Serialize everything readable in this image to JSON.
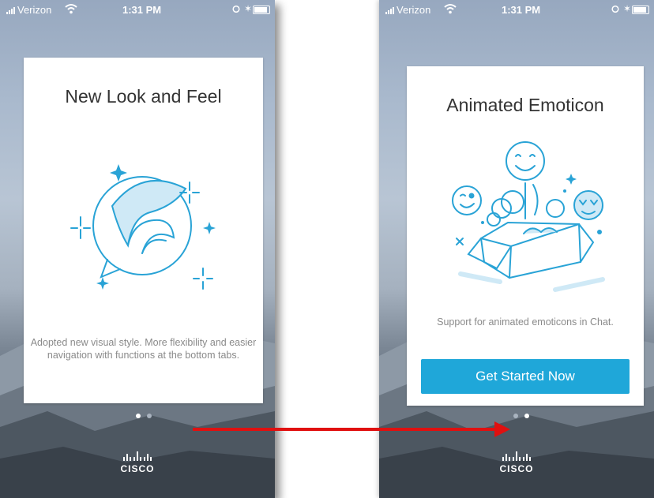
{
  "screens": [
    {
      "status": {
        "carrier": "Verizon",
        "time": "1:31 PM"
      },
      "card": {
        "title": "New Look and Feel",
        "description": "Adopted new visual style. More flexibility and easier navigation with functions at the bottom tabs.",
        "illustration_icon": "chat-bubble-icon"
      },
      "pager": {
        "page": 1,
        "total": 2
      },
      "logo_text": "CISCO"
    },
    {
      "status": {
        "carrier": "Verizon",
        "time": "1:31 PM"
      },
      "card": {
        "title": "Animated Emoticon",
        "description": "Support for animated emoticons in Chat.",
        "button_label": "Get Started Now",
        "illustration_icon": "emoticon-box-icon"
      },
      "pager": {
        "page": 2,
        "total": 2
      },
      "logo_text": "CISCO"
    }
  ],
  "colors": {
    "accent": "#1fa7d9",
    "illustration": "#29a3d6",
    "illustration_fill": "#cfe9f6",
    "arrow": "#e01010",
    "dot_active": "#ffffff",
    "dot_inactive": "#a9b3bf"
  }
}
